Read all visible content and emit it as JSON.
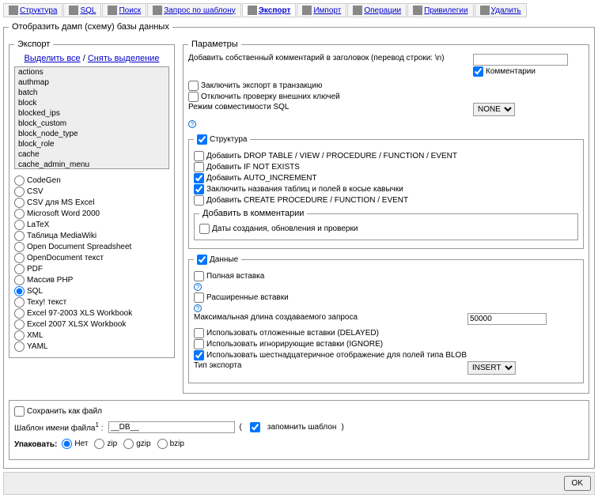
{
  "tabs": [
    {
      "label": "Структура"
    },
    {
      "label": "SQL"
    },
    {
      "label": "Поиск"
    },
    {
      "label": "Запрос по шаблону"
    },
    {
      "label": "Экспорт"
    },
    {
      "label": "Импорт"
    },
    {
      "label": "Операции"
    },
    {
      "label": "Привилегии"
    },
    {
      "label": "Удалить"
    }
  ],
  "main_legend": "Отобразить дамп (схему) базы данных",
  "export": {
    "legend": "Экспорт",
    "select_all": "Выделить все",
    "unselect_all": "Снять выделение",
    "sep": " / ",
    "tables": [
      "actions",
      "authmap",
      "batch",
      "block",
      "blocked_ips",
      "block_custom",
      "block_node_type",
      "block_role",
      "cache",
      "cache_admin_menu"
    ],
    "formats": [
      "CodeGen",
      "CSV",
      "CSV для MS Excel",
      "Microsoft Word 2000",
      "LaTeX",
      "Таблица MediaWiki",
      "Open Document Spreadsheet",
      "OpenDocument текст",
      "PDF",
      "Массив PHP",
      "SQL",
      "Texy! текст",
      "Excel 97-2003 XLS Workbook",
      "Excel 2007 XLSX Workbook",
      "XML",
      "YAML"
    ],
    "selected_format": "SQL"
  },
  "params": {
    "legend": "Параметры",
    "comment_label": "Добавить собственный комментарий в заголовок (перевод строки: \\n)",
    "comment_value": "",
    "comments_cb": "Комментарии",
    "transaction": "Заключить экспорт в транзакцию",
    "disable_fk": "Отключить проверку внешних ключей",
    "compat_label": "Режим совместимости SQL",
    "compat_value": "NONE",
    "structure": {
      "legend": "Структура",
      "drop": "Добавить DROP TABLE / VIEW / PROCEDURE / FUNCTION / EVENT",
      "ifnot": "Добавить IF NOT EXISTS",
      "autoinc": "Добавить AUTO_INCREMENT",
      "backq": "Заключить названия таблиц и полей в косые кавычки",
      "createproc": "Добавить CREATE PROCEDURE / FUNCTION / EVENT",
      "comments_legend": "Добавить в комментарии",
      "dates": "Даты создания, обновления и проверки"
    },
    "data": {
      "legend": "Данные",
      "full": "Полная вставка",
      "ext": "Расширенные вставки",
      "maxlen_label": "Максимальная длина создаваемого запроса",
      "maxlen_value": "50000",
      "delayed": "Использовать отложенные вставки (DELAYED)",
      "ignore": "Использовать игнорирующие вставки (IGNORE)",
      "hexblob": "Использовать шестнадцатеричное отображение для полей типа BLOB",
      "export_type_label": "Тип экспорта",
      "export_type_value": "INSERT"
    }
  },
  "save": {
    "save_as_file": "Сохранить как файл",
    "template_label": "Шаблон имени файла",
    "template_value": "__DB__",
    "remember": "запомнить шаблон",
    "pack_label": "Упаковать:",
    "pack_options": [
      "Нет",
      "zip",
      "gzip",
      "bzip"
    ]
  },
  "ok": "OK"
}
